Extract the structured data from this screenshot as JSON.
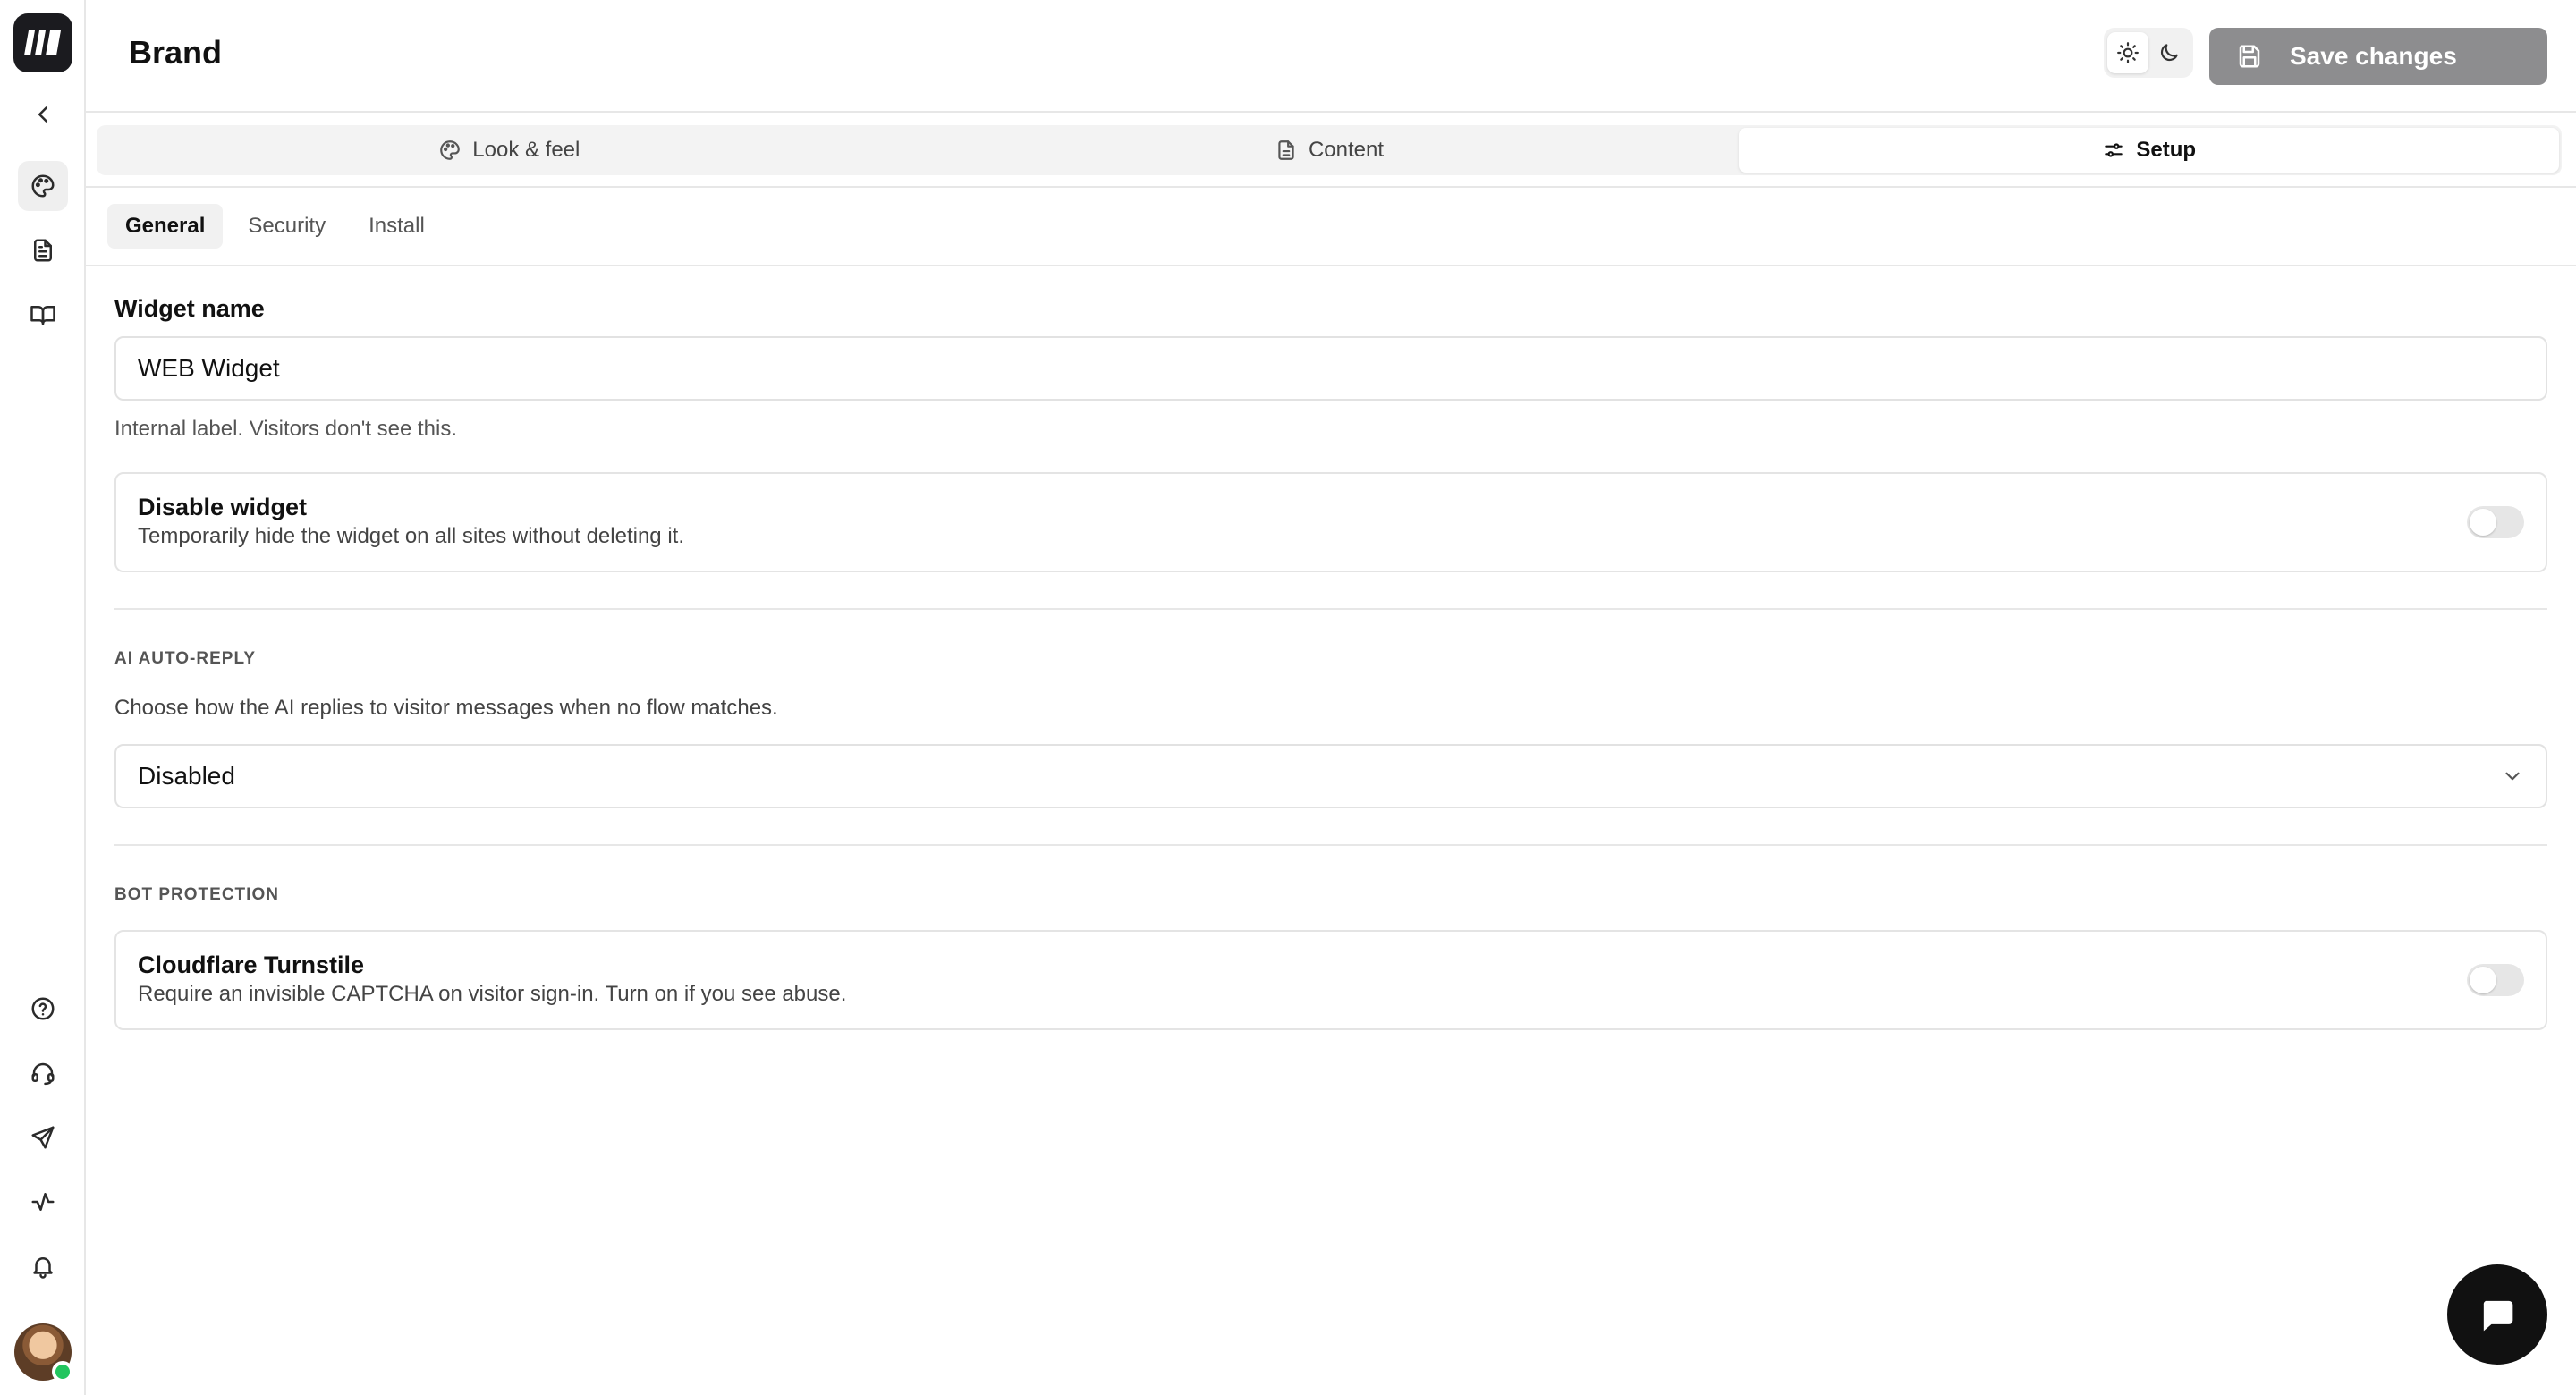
{
  "header": {
    "title": "Brand",
    "save_label": "Save changes"
  },
  "main_tabs": [
    {
      "label": "Look & feel",
      "icon": "palette-icon"
    },
    {
      "label": "Content",
      "icon": "document-icon"
    },
    {
      "label": "Setup",
      "icon": "sliders-icon",
      "active": true
    }
  ],
  "sub_tabs": [
    {
      "label": "General",
      "active": true
    },
    {
      "label": "Security"
    },
    {
      "label": "Install"
    }
  ],
  "form": {
    "widget_name_label": "Widget name",
    "widget_name_value": "WEB Widget",
    "widget_name_hint": "Internal label. Visitors don't see this.",
    "disable_widget": {
      "title": "Disable widget",
      "description": "Temporarily hide the widget on all sites without deleting it.",
      "enabled": false
    },
    "ai_auto_reply": {
      "section_label": "AI AUTO-REPLY",
      "description": "Choose how the AI replies to visitor messages when no flow matches.",
      "selected": "Disabled"
    },
    "bot_protection": {
      "section_label": "BOT PROTECTION",
      "title": "Cloudflare Turnstile",
      "description": "Require an invisible CAPTCHA on visitor sign-in. Turn on if you see abuse.",
      "enabled": false
    }
  },
  "rail": {
    "icons": [
      "back-icon",
      "palette-icon",
      "document-icon",
      "book-icon",
      "help-icon",
      "headset-icon",
      "send-icon",
      "activity-icon",
      "bell-icon"
    ],
    "online_status_color": "#22c55e"
  },
  "colors": {
    "save_button_bg": "#8d8d8f",
    "chat_fab_bg": "#111111"
  }
}
